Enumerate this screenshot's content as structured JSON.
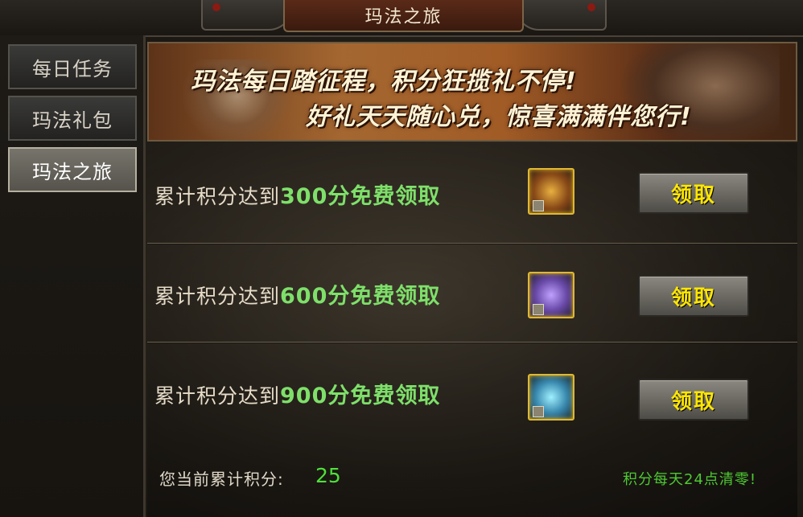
{
  "window": {
    "title": "玛法之旅"
  },
  "sidebar": {
    "items": [
      {
        "label": "每日任务",
        "active": false
      },
      {
        "label": "玛法礼包",
        "active": false
      },
      {
        "label": "玛法之旅",
        "active": true
      }
    ]
  },
  "banner": {
    "line1": "玛法每日踏征程，积分狂揽礼不停!",
    "line2": "好礼天天随心兑，惊喜满满伴您行!"
  },
  "rewards": [
    {
      "prefix": "累计积分达到 ",
      "highlight": "300分免费领取",
      "chest": "gold-chest-icon",
      "button": "领取"
    },
    {
      "prefix": "累计积分达到 ",
      "highlight": "600分免费领取",
      "chest": "purple-chest-icon",
      "button": "领取"
    },
    {
      "prefix": "累计积分达到 ",
      "highlight": "900分免费领取",
      "chest": "blue-chest-icon",
      "button": "领取"
    }
  ],
  "footer": {
    "points_label": "您当前累计积分:",
    "points_value": "25",
    "reset_note": "积分每天24点清零!"
  },
  "colors": {
    "highlight_green": "#7ee06a",
    "button_text": "#ffe600",
    "points_green": "#4ee03a"
  }
}
